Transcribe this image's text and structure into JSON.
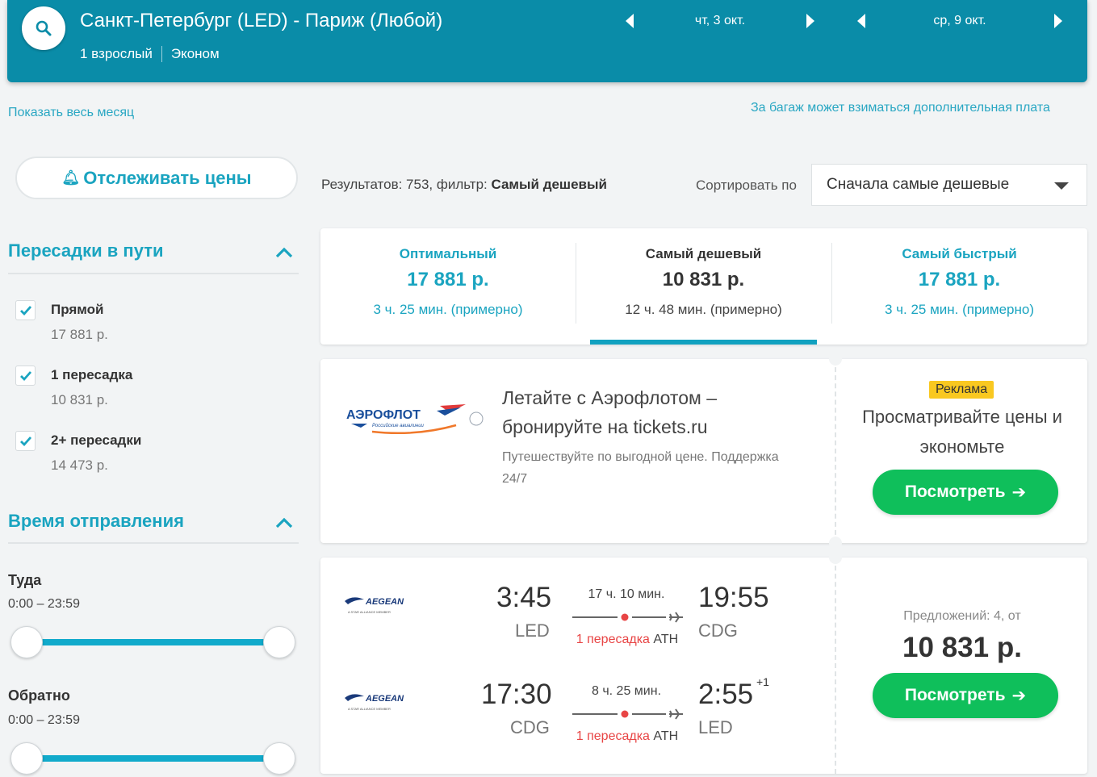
{
  "header": {
    "route": "Санкт-Петербург (LED) - Париж (Любой)",
    "passengers": "1 взрослый",
    "cabin": "Эконом",
    "depart_date": "чт, 3 окт.",
    "return_date": "ср, 9 окт."
  },
  "links": {
    "show_month": "Показать весь месяц",
    "baggage_note": "За багаж может взиматься дополнительная плата"
  },
  "sidebar": {
    "track_label": "Отслеживать цены",
    "stops_title": "Пересадки в пути",
    "stops": [
      {
        "label": "Прямой",
        "price": "17 881 р.",
        "checked": true
      },
      {
        "label": "1 пересадка",
        "price": "10 831 р.",
        "checked": true
      },
      {
        "label": "2+ пересадки",
        "price": "14 473 р.",
        "checked": true
      }
    ],
    "time_title": "Время отправления",
    "outbound_label": "Туда",
    "outbound_range": "0:00 – 23:59",
    "return_label": "Обратно",
    "return_range": "0:00 – 23:59"
  },
  "results": {
    "count_text": "Результатов: 753, фильтр: ",
    "filter_name": "Самый дешевый",
    "sort_label": "Сортировать по",
    "sort_value": "Сначала самые дешевые"
  },
  "tabs": [
    {
      "name": "Оптимальный",
      "price": "17 881 р.",
      "duration": "3 ч. 25 мин. (примерно)"
    },
    {
      "name": "Самый дешевый",
      "price": "10 831 р.",
      "duration": "12 ч. 48 мин. (примерно)"
    },
    {
      "name": "Самый быстрый",
      "price": "17 881 р.",
      "duration": "3 ч. 25 мин. (примерно)"
    }
  ],
  "ad": {
    "logo_text": "АЭРОФЛОТ",
    "logo_sub": "Российские авиалинии",
    "title": "Летайте с Аэрофлотом – бронируйте на tickets.ru",
    "text": "Путешествуйте по выгодной цене. Поддержка 24/7",
    "badge": "Реклама",
    "right_text": "Просматривайте цены и экономьте",
    "button": "Посмотреть"
  },
  "flight": {
    "outbound": {
      "airline": "AEGEAN",
      "airline_sub": "A STAR ALLIANCE MEMBER",
      "dep_time": "3:45",
      "dep_airport": "LED",
      "duration": "17 ч. 10 мин.",
      "stops": "1 пересадка",
      "stop_airport": "ATH",
      "arr_time": "19:55",
      "arr_airport": "CDG"
    },
    "inbound": {
      "airline": "AEGEAN",
      "airline_sub": "A STAR ALLIANCE MEMBER",
      "dep_time": "17:30",
      "dep_airport": "CDG",
      "duration": "8 ч. 25 мин.",
      "stops": "1 пересадка",
      "stop_airport": "ATH",
      "arr_time": "2:55",
      "arr_plus": "+1",
      "arr_airport": "LED"
    },
    "offers": "Предложений: 4, от",
    "price": "10 831 р.",
    "button": "Посмотреть"
  },
  "colors": {
    "header_bg": "#0a8ca8",
    "accent": "#1aa4c0",
    "cta_green": "#0fbf5b",
    "stop_red": "#e84545",
    "badge_yellow": "#f9c820"
  }
}
